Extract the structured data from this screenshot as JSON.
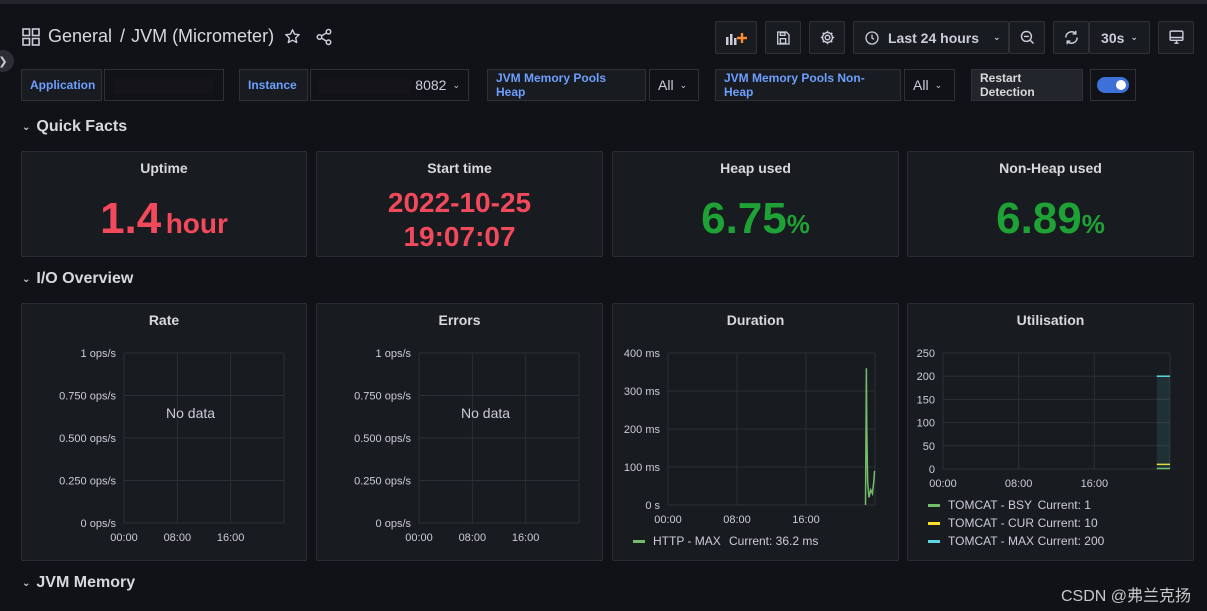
{
  "dashboard": {
    "folder": "General",
    "separator": "/",
    "name": "JVM (Micrometer)"
  },
  "toolbar": {
    "time_range": "Last 24 hours",
    "refresh_interval": "30s"
  },
  "variables": {
    "application_label": "Application",
    "instance_label": "Instance",
    "instance_value": "8082",
    "heap_label": "JVM Memory Pools Heap",
    "heap_value": "All",
    "nonheap_label": "JVM Memory Pools Non-Heap",
    "nonheap_value": "All",
    "restart_label": "Restart Detection",
    "restart_enabled": true
  },
  "rows": {
    "quick_facts": "Quick Facts",
    "io_overview": "I/O Overview",
    "jvm_memory": "JVM Memory"
  },
  "quick_facts": {
    "uptime": {
      "title": "Uptime",
      "value": "1.4",
      "unit": "hour"
    },
    "start_time": {
      "title": "Start time",
      "date": "2022-10-25",
      "time": "19:07:07"
    },
    "heap_used": {
      "title": "Heap used",
      "value": "6.75",
      "unit": "%"
    },
    "nonheap_used": {
      "title": "Non-Heap used",
      "value": "6.89",
      "unit": "%"
    }
  },
  "watermark": "CSDN @弗兰克扬",
  "colors": {
    "red": "#f2495c",
    "green": "#1ea236",
    "accent_blue": "#6e9fff",
    "series_green": "#73bf69",
    "series_yellow": "#fade2a",
    "series_cyan": "#5ad7e0"
  },
  "chart_data": [
    {
      "type": "line",
      "title": "Rate",
      "x": [
        "00:00",
        "08:00",
        "16:00"
      ],
      "yticks": [
        "1 ops/s",
        "0.750 ops/s",
        "0.500 ops/s",
        "0.250 ops/s",
        "0 ops/s"
      ],
      "ylim": [
        0,
        1
      ],
      "no_data": "No data",
      "series": []
    },
    {
      "type": "line",
      "title": "Errors",
      "x": [
        "00:00",
        "08:00",
        "16:00"
      ],
      "yticks": [
        "1 ops/s",
        "0.750 ops/s",
        "0.500 ops/s",
        "0.250 ops/s",
        "0 ops/s"
      ],
      "ylim": [
        0,
        1
      ],
      "no_data": "No data",
      "series": []
    },
    {
      "type": "line",
      "title": "Duration",
      "x": [
        "00:00",
        "08:00",
        "16:00"
      ],
      "yticks": [
        "400 ms",
        "300 ms",
        "200 ms",
        "100 ms",
        "0 s"
      ],
      "ylim": [
        0,
        400
      ],
      "series": [
        {
          "name": "HTTP - MAX",
          "current": "Current: 36.2 ms",
          "color": "#73bf69",
          "points": [
            [
              22.9,
              0
            ],
            [
              23.0,
              360
            ],
            [
              23.05,
              200
            ],
            [
              23.15,
              60
            ],
            [
              23.3,
              20
            ],
            [
              23.5,
              40
            ],
            [
              23.7,
              30
            ],
            [
              23.85,
              60
            ],
            [
              23.95,
              90
            ]
          ]
        }
      ]
    },
    {
      "type": "line",
      "title": "Utilisation",
      "x": [
        "00:00",
        "08:00",
        "16:00"
      ],
      "yticks": [
        "250",
        "200",
        "150",
        "100",
        "50",
        "0"
      ],
      "ylim": [
        0,
        250
      ],
      "series": [
        {
          "name": "TOMCAT - BSY",
          "current": "Current: 1",
          "color": "#73bf69",
          "points": [
            [
              22.6,
              1
            ],
            [
              24,
              1
            ]
          ]
        },
        {
          "name": "TOMCAT - CUR",
          "current": "Current: 10",
          "color": "#fade2a",
          "points": [
            [
              22.6,
              10
            ],
            [
              24,
              10
            ]
          ]
        },
        {
          "name": "TOMCAT - MAX",
          "current": "Current: 200",
          "color": "#5ad7e0",
          "points": [
            [
              22.6,
              200
            ],
            [
              24,
              200
            ]
          ]
        }
      ]
    }
  ]
}
